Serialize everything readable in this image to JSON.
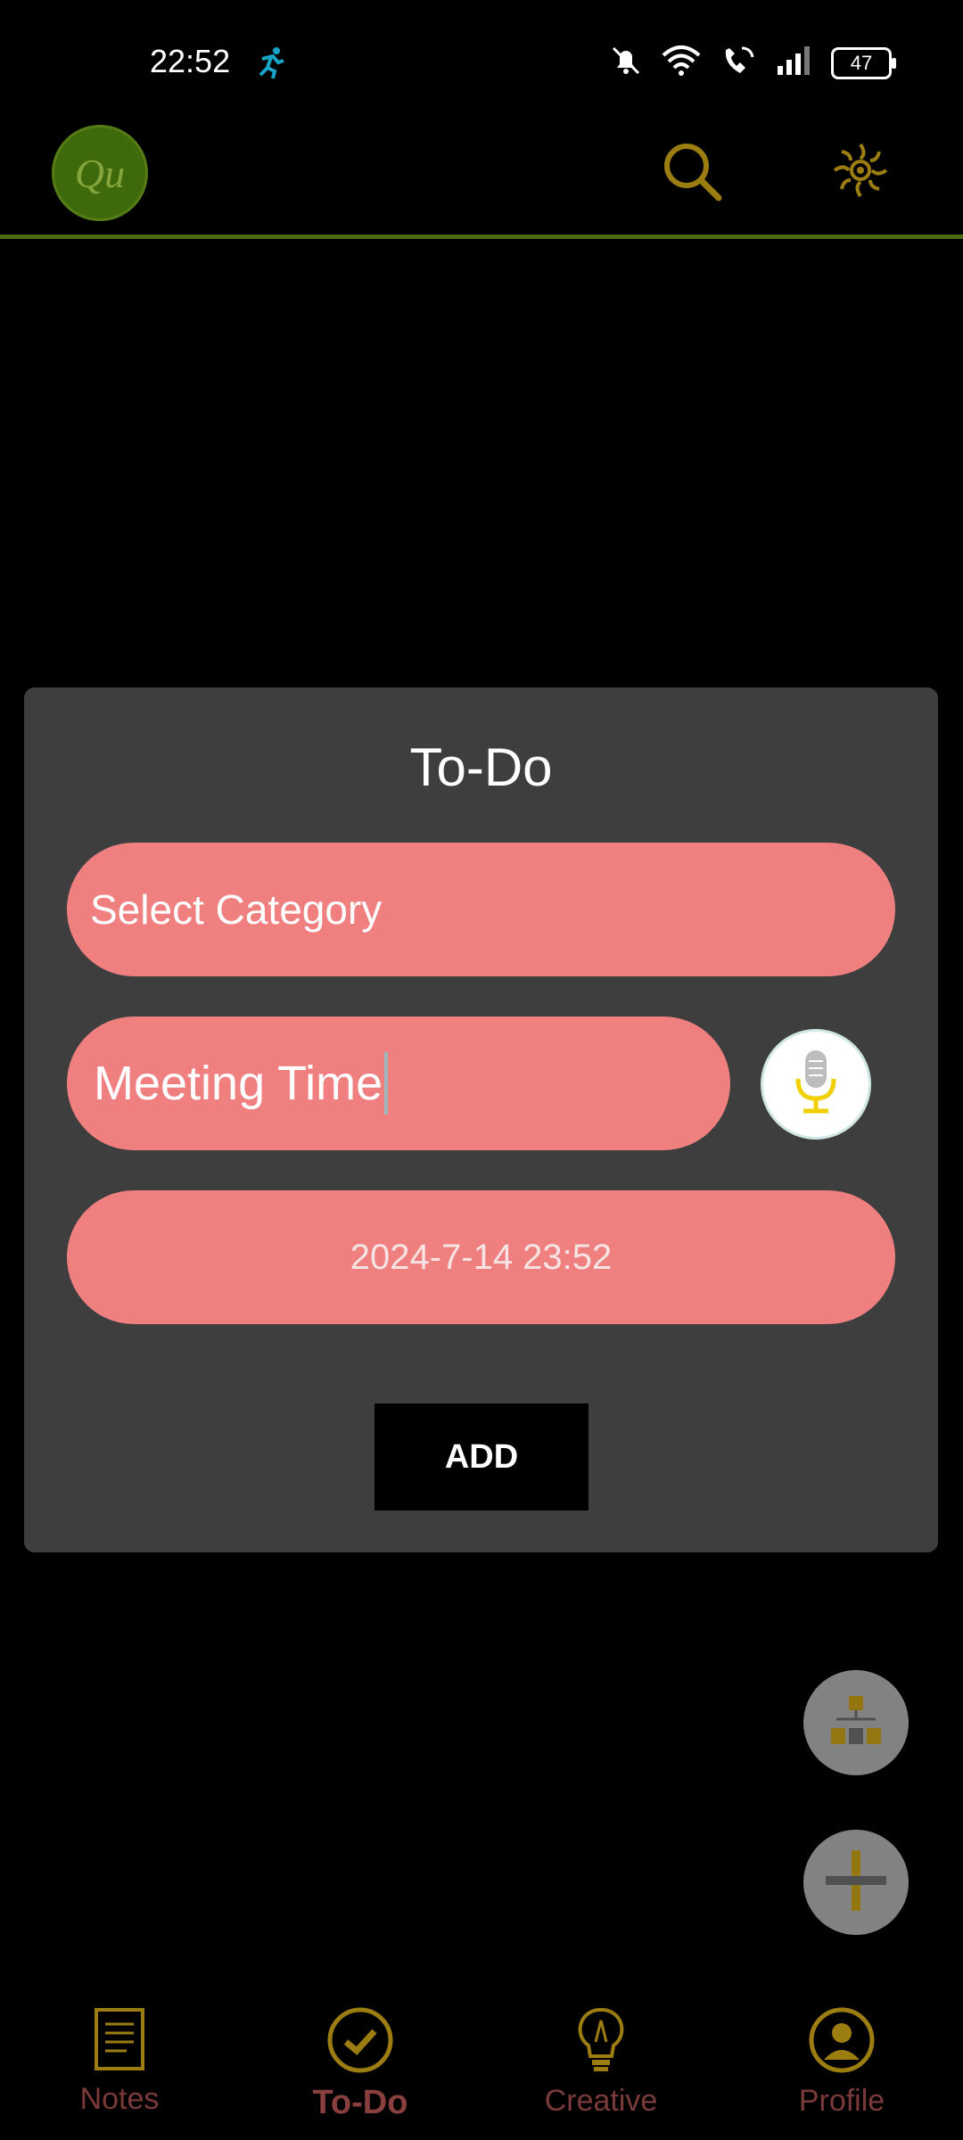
{
  "status": {
    "time": "22:52",
    "battery": "47"
  },
  "app": {
    "logo_text": "Qu"
  },
  "dialog": {
    "title": "To-Do",
    "category_placeholder": "Select Category",
    "task_value": "Meeting Time",
    "date_time": "2024-7-14 23:52",
    "add_label": "ADD"
  },
  "nav": {
    "items": [
      {
        "label": "Notes",
        "icon": "notes-icon"
      },
      {
        "label": "To-Do",
        "icon": "check-circle-icon",
        "active": true
      },
      {
        "label": "Creative",
        "icon": "lightbulb-icon"
      },
      {
        "label": "Profile",
        "icon": "profile-icon"
      }
    ]
  },
  "colors": {
    "pill": "#f08080",
    "dialog": "#3e3e3e",
    "accent_gold": "#9c7d12",
    "accent_green": "#4b6b13",
    "nav_text": "#7a3a3a"
  }
}
